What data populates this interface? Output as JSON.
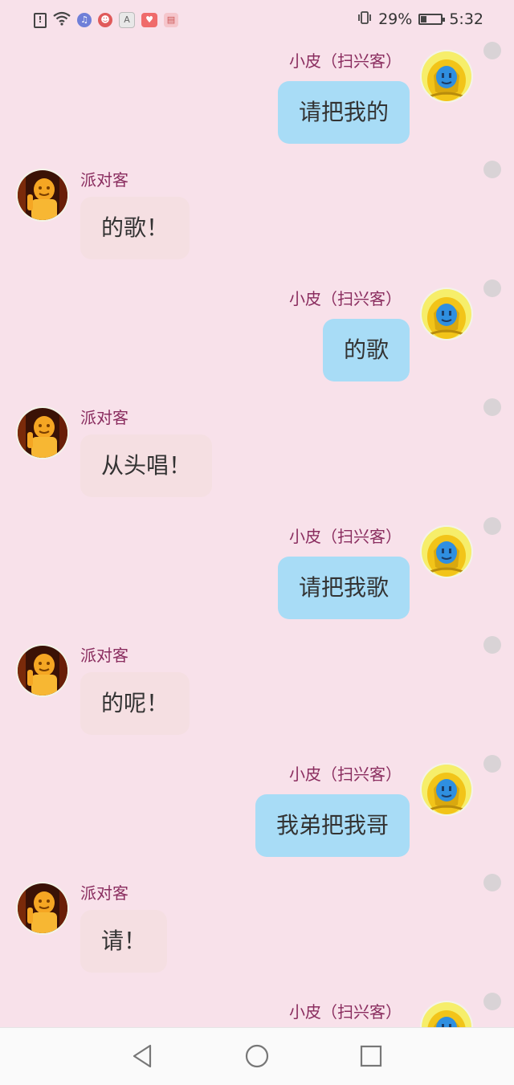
{
  "status_bar": {
    "battery_percent": "29%",
    "battery_level": 0.29,
    "time": "5:32",
    "icons": [
      "sim-alert-icon",
      "wifi-icon",
      "music-app-icon",
      "pet-app-icon",
      "text-app-icon",
      "red-app-icon",
      "cake-app-icon"
    ]
  },
  "chat": {
    "messages": [
      {
        "side": "right",
        "sender": "小皮（扫兴客）",
        "text": "请把我的",
        "avatar": "yellow-hood-blue-face"
      },
      {
        "side": "left",
        "sender": "派对客",
        "text": "的歌！",
        "avatar": "orange-figure-dark"
      },
      {
        "side": "right",
        "sender": "小皮（扫兴客）",
        "text": "的歌",
        "avatar": "yellow-hood-blue-face"
      },
      {
        "side": "left",
        "sender": "派对客",
        "text": "从头唱！",
        "avatar": "orange-figure-dark"
      },
      {
        "side": "right",
        "sender": "小皮（扫兴客）",
        "text": "请把我歌",
        "avatar": "yellow-hood-blue-face"
      },
      {
        "side": "left",
        "sender": "派对客",
        "text": "的呢！",
        "avatar": "orange-figure-dark"
      },
      {
        "side": "right",
        "sender": "小皮（扫兴客）",
        "text": "我弟把我哥",
        "avatar": "yellow-hood-blue-face"
      },
      {
        "side": "left",
        "sender": "派对客",
        "text": "请！",
        "avatar": "orange-figure-dark"
      },
      {
        "side": "right",
        "sender": "小皮（扫兴客）",
        "text": "",
        "avatar": "yellow-hood-blue-face"
      }
    ]
  },
  "colors": {
    "background": "#f8e1ea",
    "my_bubble": "#a8dcf6",
    "their_bubble": "#f5dfe2",
    "sender_name": "#8a2d5f"
  },
  "nav_bar": {
    "buttons": [
      "back-icon",
      "home-icon",
      "recents-icon"
    ]
  }
}
